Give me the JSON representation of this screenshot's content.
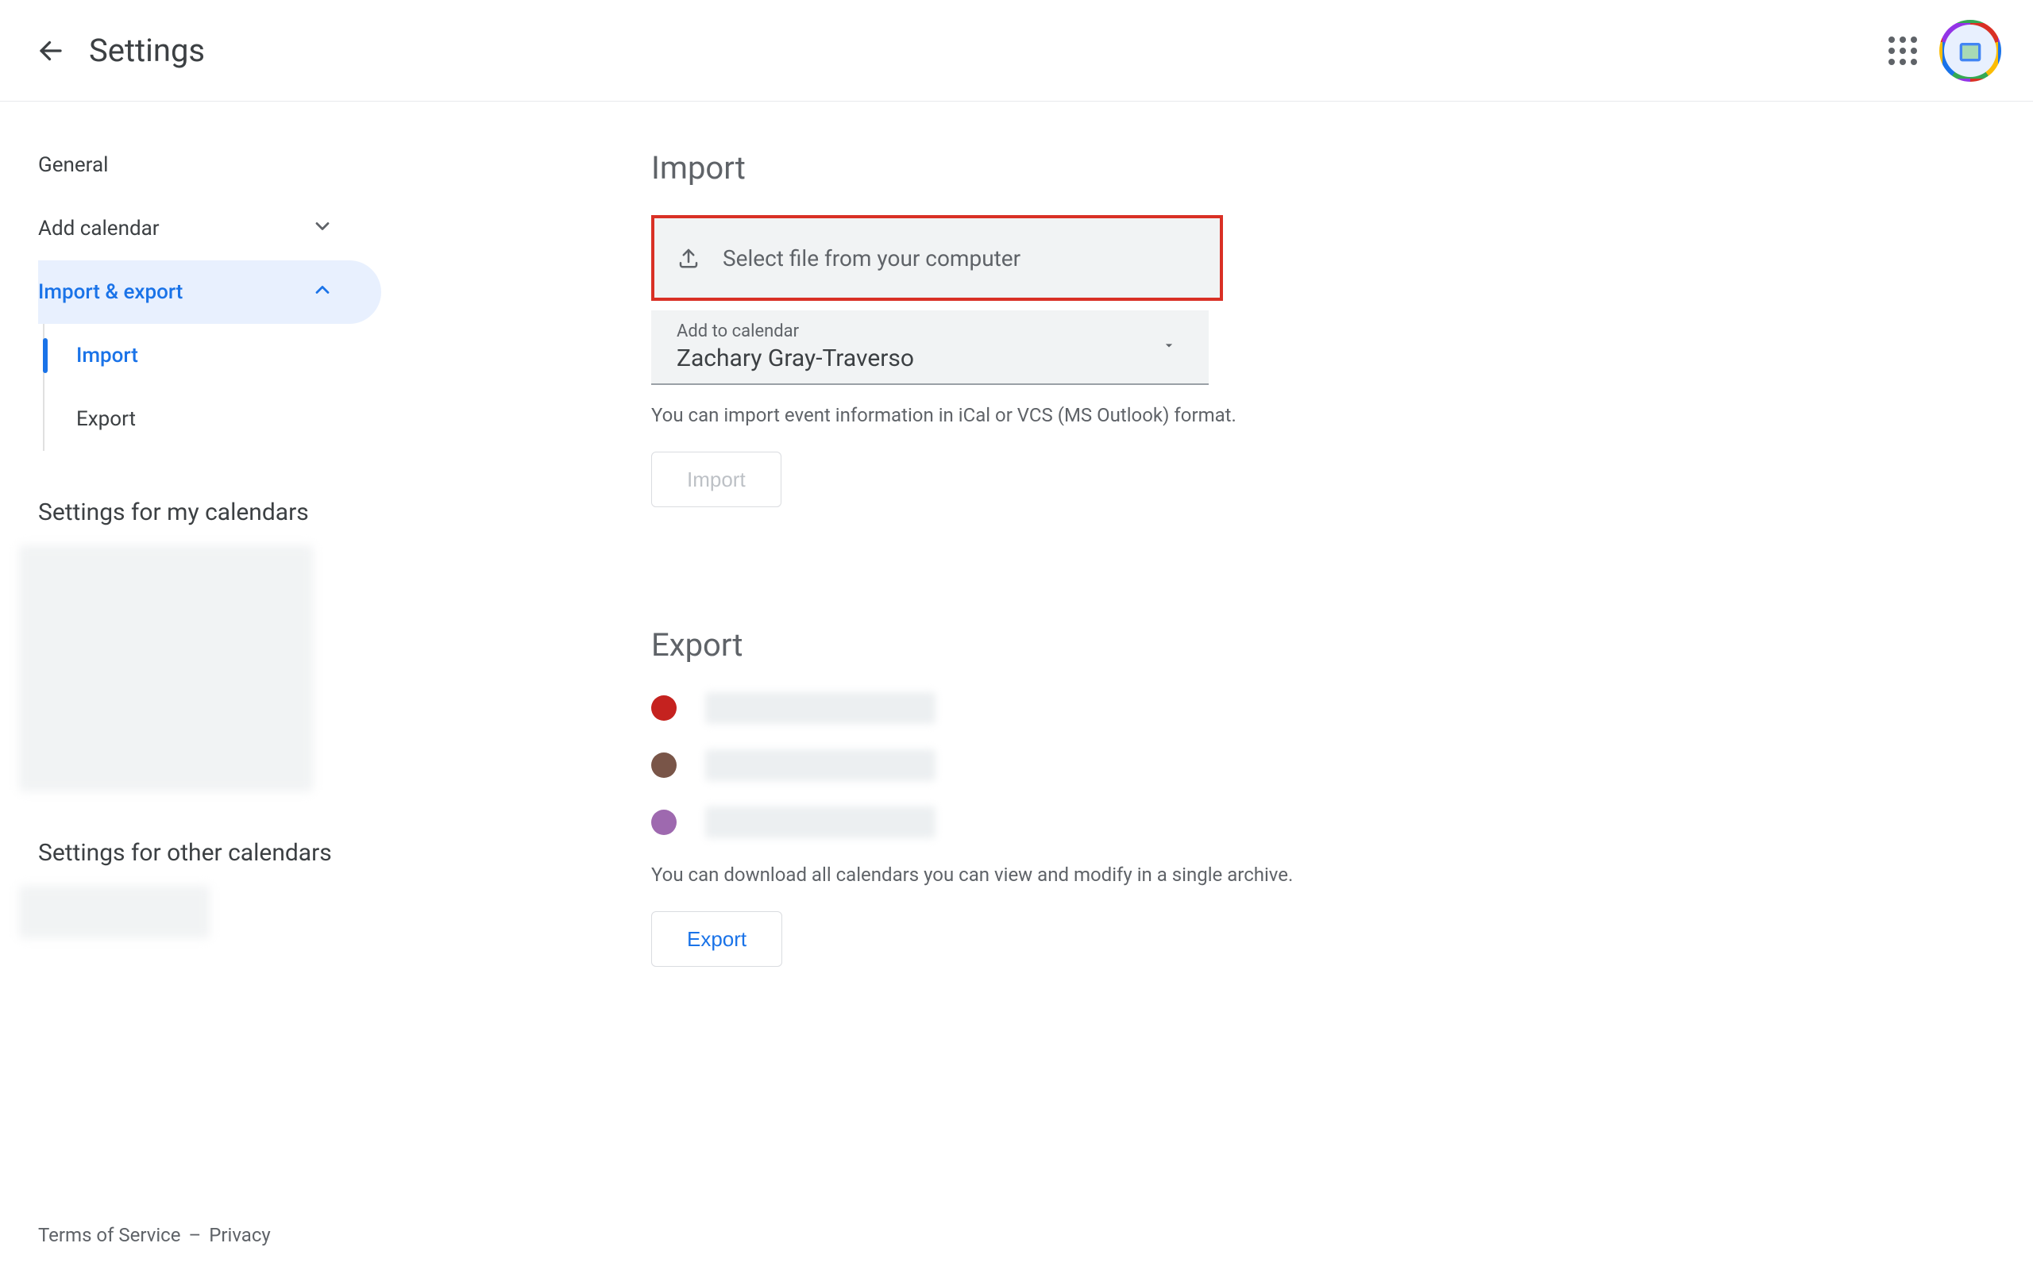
{
  "header": {
    "title": "Settings"
  },
  "sidebar": {
    "general": "General",
    "add_calendar": "Add calendar",
    "import_export": "Import & export",
    "sub": {
      "import": "Import",
      "export": "Export"
    },
    "my_calendars_label": "Settings for my calendars",
    "other_calendars_label": "Settings for other calendars"
  },
  "import": {
    "title": "Import",
    "select_file": "Select file from your computer",
    "add_to_label": "Add to calendar",
    "add_to_value": "Zachary Gray-Traverso",
    "help": "You can import event information in iCal or VCS (MS Outlook) format.",
    "button": "Import"
  },
  "export": {
    "title": "Export",
    "calendars": [
      {
        "color": "#c5221f"
      },
      {
        "color": "#795548"
      },
      {
        "color": "#9e69af"
      }
    ],
    "help": "You can download all calendars you can view and modify in a single archive.",
    "button": "Export"
  },
  "footer": {
    "terms": "Terms of Service",
    "sep": "–",
    "privacy": "Privacy"
  }
}
